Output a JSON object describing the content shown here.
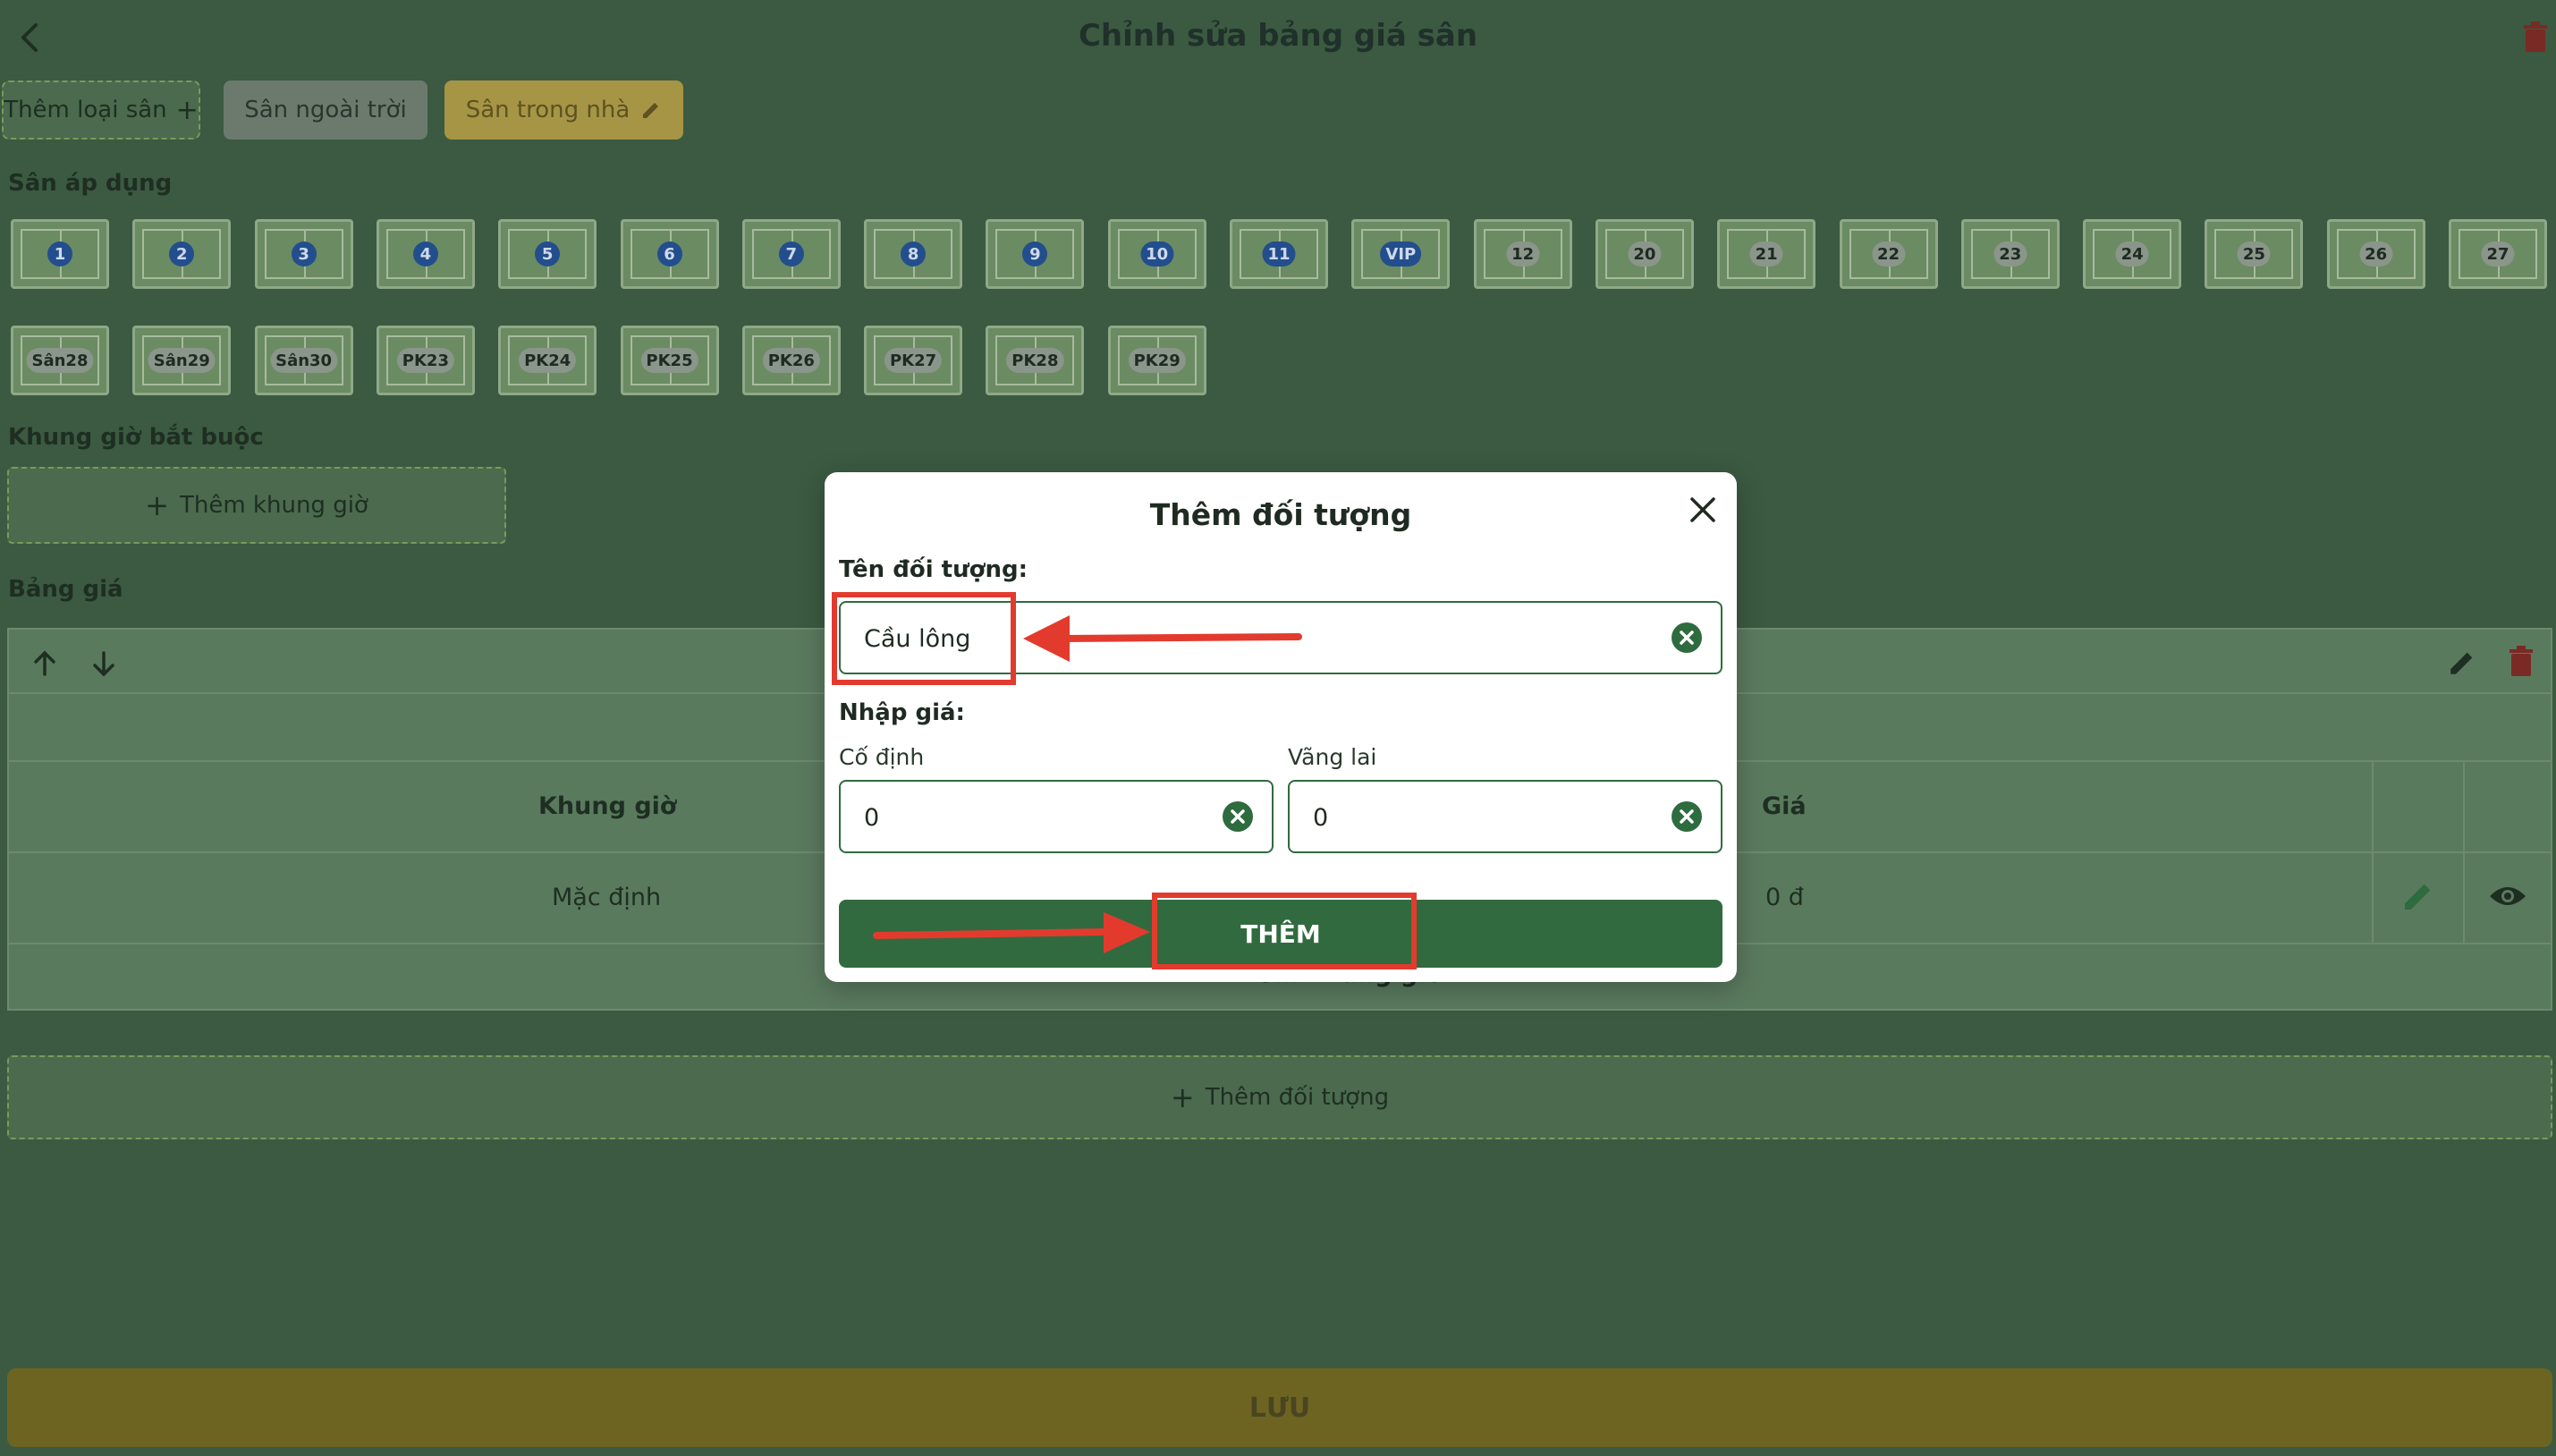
{
  "header": {
    "title": "Chỉnh sửa bảng giá sân"
  },
  "tabs": {
    "add_label": "Thêm loại sân",
    "outdoor": "Sân ngoài trời",
    "indoor": "Sân trong nhà"
  },
  "courts": {
    "section_label": "Sân áp dụng",
    "row1": [
      "1",
      "2",
      "3",
      "4",
      "5",
      "6",
      "7",
      "8",
      "9",
      "10",
      "11",
      "VIP",
      "12",
      "20",
      "21",
      "22",
      "23",
      "24",
      "25",
      "26",
      "27"
    ],
    "row2": [
      "Sân28",
      "Sân29",
      "Sân30",
      "PK23",
      "PK24",
      "PK25",
      "PK26",
      "PK27",
      "PK28",
      "PK29"
    ]
  },
  "timeslots": {
    "section_label": "Khung giờ bắt buộc",
    "add_label": "Thêm khung giờ"
  },
  "pricing": {
    "section_label": "Bảng giá",
    "col_time": "Khung giờ",
    "col_price": "Giá",
    "row_time": "Mặc định",
    "row_price": "0 đ",
    "add_timeslot": "Thêm khung giờ"
  },
  "add_object": {
    "label": "Thêm đối tượng"
  },
  "save": {
    "label": "LƯU"
  },
  "modal": {
    "title": "Thêm đối tượng",
    "name_label": "Tên đối tượng:",
    "name_value": "Cầu lông",
    "price_label": "Nhập giá:",
    "fixed_label": "Cố định",
    "fixed_value": "0",
    "walkin_label": "Vãng lai",
    "walkin_value": "0",
    "submit": "THÊM"
  },
  "colors": {
    "accent": "#316a3f",
    "highlight": "#e23b2e",
    "gold": "#a59545"
  }
}
